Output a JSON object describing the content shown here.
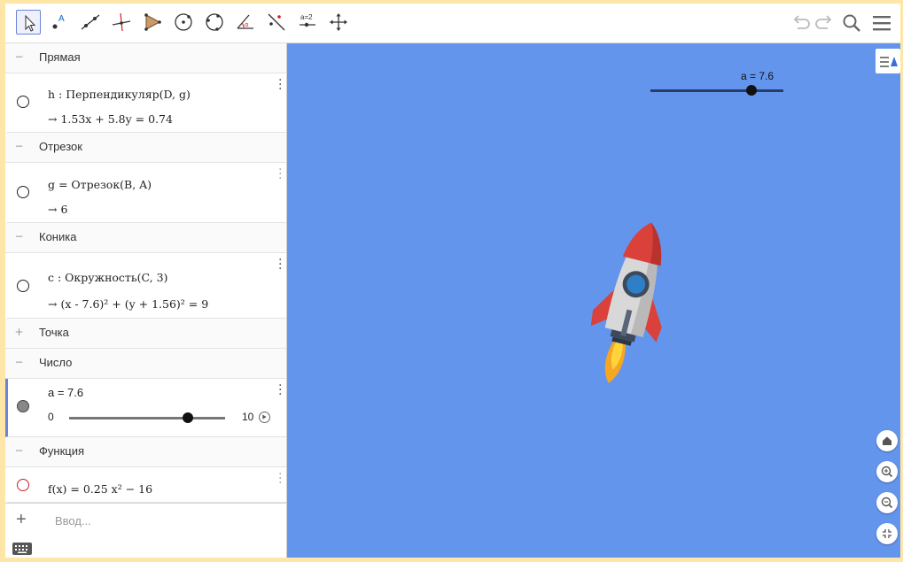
{
  "algebra": {
    "groups": [
      {
        "title": "Прямая",
        "toggle": "−"
      },
      {
        "title": "Отрезок",
        "toggle": "−"
      },
      {
        "title": "Коника",
        "toggle": "−"
      },
      {
        "title": "Точка",
        "toggle": "+"
      },
      {
        "title": "Число",
        "toggle": "−"
      },
      {
        "title": "Функция",
        "toggle": "−"
      }
    ],
    "items": {
      "line": {
        "definition": "h : Перпендикуляр(D, g)",
        "value": "→  1.53x + 5.8y = 0.74"
      },
      "segment": {
        "definition": "g = Отрезок(B, A)",
        "value": "→  6"
      },
      "conic": {
        "definition": "c : Окружность(C, 3)",
        "value": "→  (x - 7.6)² + (y + 1.56)² = 9"
      },
      "number": {
        "definition": "a = 7.6",
        "min": "0",
        "max": "10",
        "slider_fraction": 0.76
      },
      "function": {
        "definition": "f(x) = 0.25 x² − 16"
      }
    },
    "input_placeholder": "Ввод...",
    "input_plus": "+"
  },
  "graphics": {
    "slider_label": "a = 7.6",
    "slider_fraction": 0.76,
    "background_color": "#6495ed"
  },
  "toolbar": {
    "tools": [
      "move-icon",
      "point-icon",
      "line-icon",
      "perpendicular-icon",
      "polygon-icon",
      "circle-center-icon",
      "circle-three-points-icon",
      "angle-icon",
      "reflect-icon",
      "slider-icon",
      "move-view-icon"
    ],
    "right": [
      "undo-icon",
      "redo-icon",
      "search-icon",
      "menu-icon"
    ]
  },
  "colors": {
    "accent": "#6d83d6",
    "canvas": "#6495ed",
    "rocket_red": "#d9413a",
    "rocket_body": "#d8d8d8",
    "window": "#2f7fc8",
    "flame": "#f5a623"
  }
}
